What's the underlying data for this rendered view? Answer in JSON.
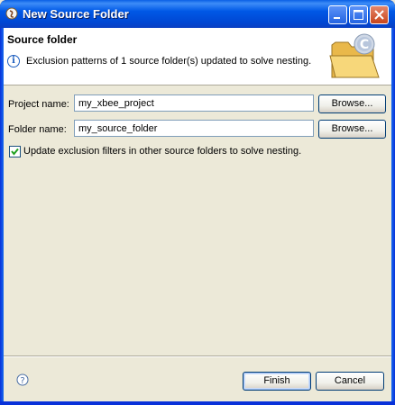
{
  "window": {
    "title": "New Source Folder",
    "controls": {
      "minimize": "minimize",
      "maximize": "maximize",
      "close": "close"
    }
  },
  "header": {
    "title": "Source folder",
    "message": "Exclusion patterns of 1 source folder(s) updated to solve nesting."
  },
  "form": {
    "project_label": "Project name:",
    "project_value": "my_xbee_project",
    "folder_label": "Folder name:",
    "folder_value": "my_source_folder",
    "browse_label": "Browse...",
    "checkbox_label": "Update exclusion filters in other source folders to solve nesting.",
    "checkbox_checked": true
  },
  "footer": {
    "finish_label": "Finish",
    "cancel_label": "Cancel"
  },
  "icons": {
    "app": "eclipse-java-icon",
    "info": "info-icon",
    "wizard": "folder-with-c-icon",
    "help": "help-icon"
  },
  "colors": {
    "titlebar": "#0058e6",
    "dialog_bg": "#ece9d8",
    "header_bg": "#ffffff",
    "checkmark": "#21a121"
  }
}
